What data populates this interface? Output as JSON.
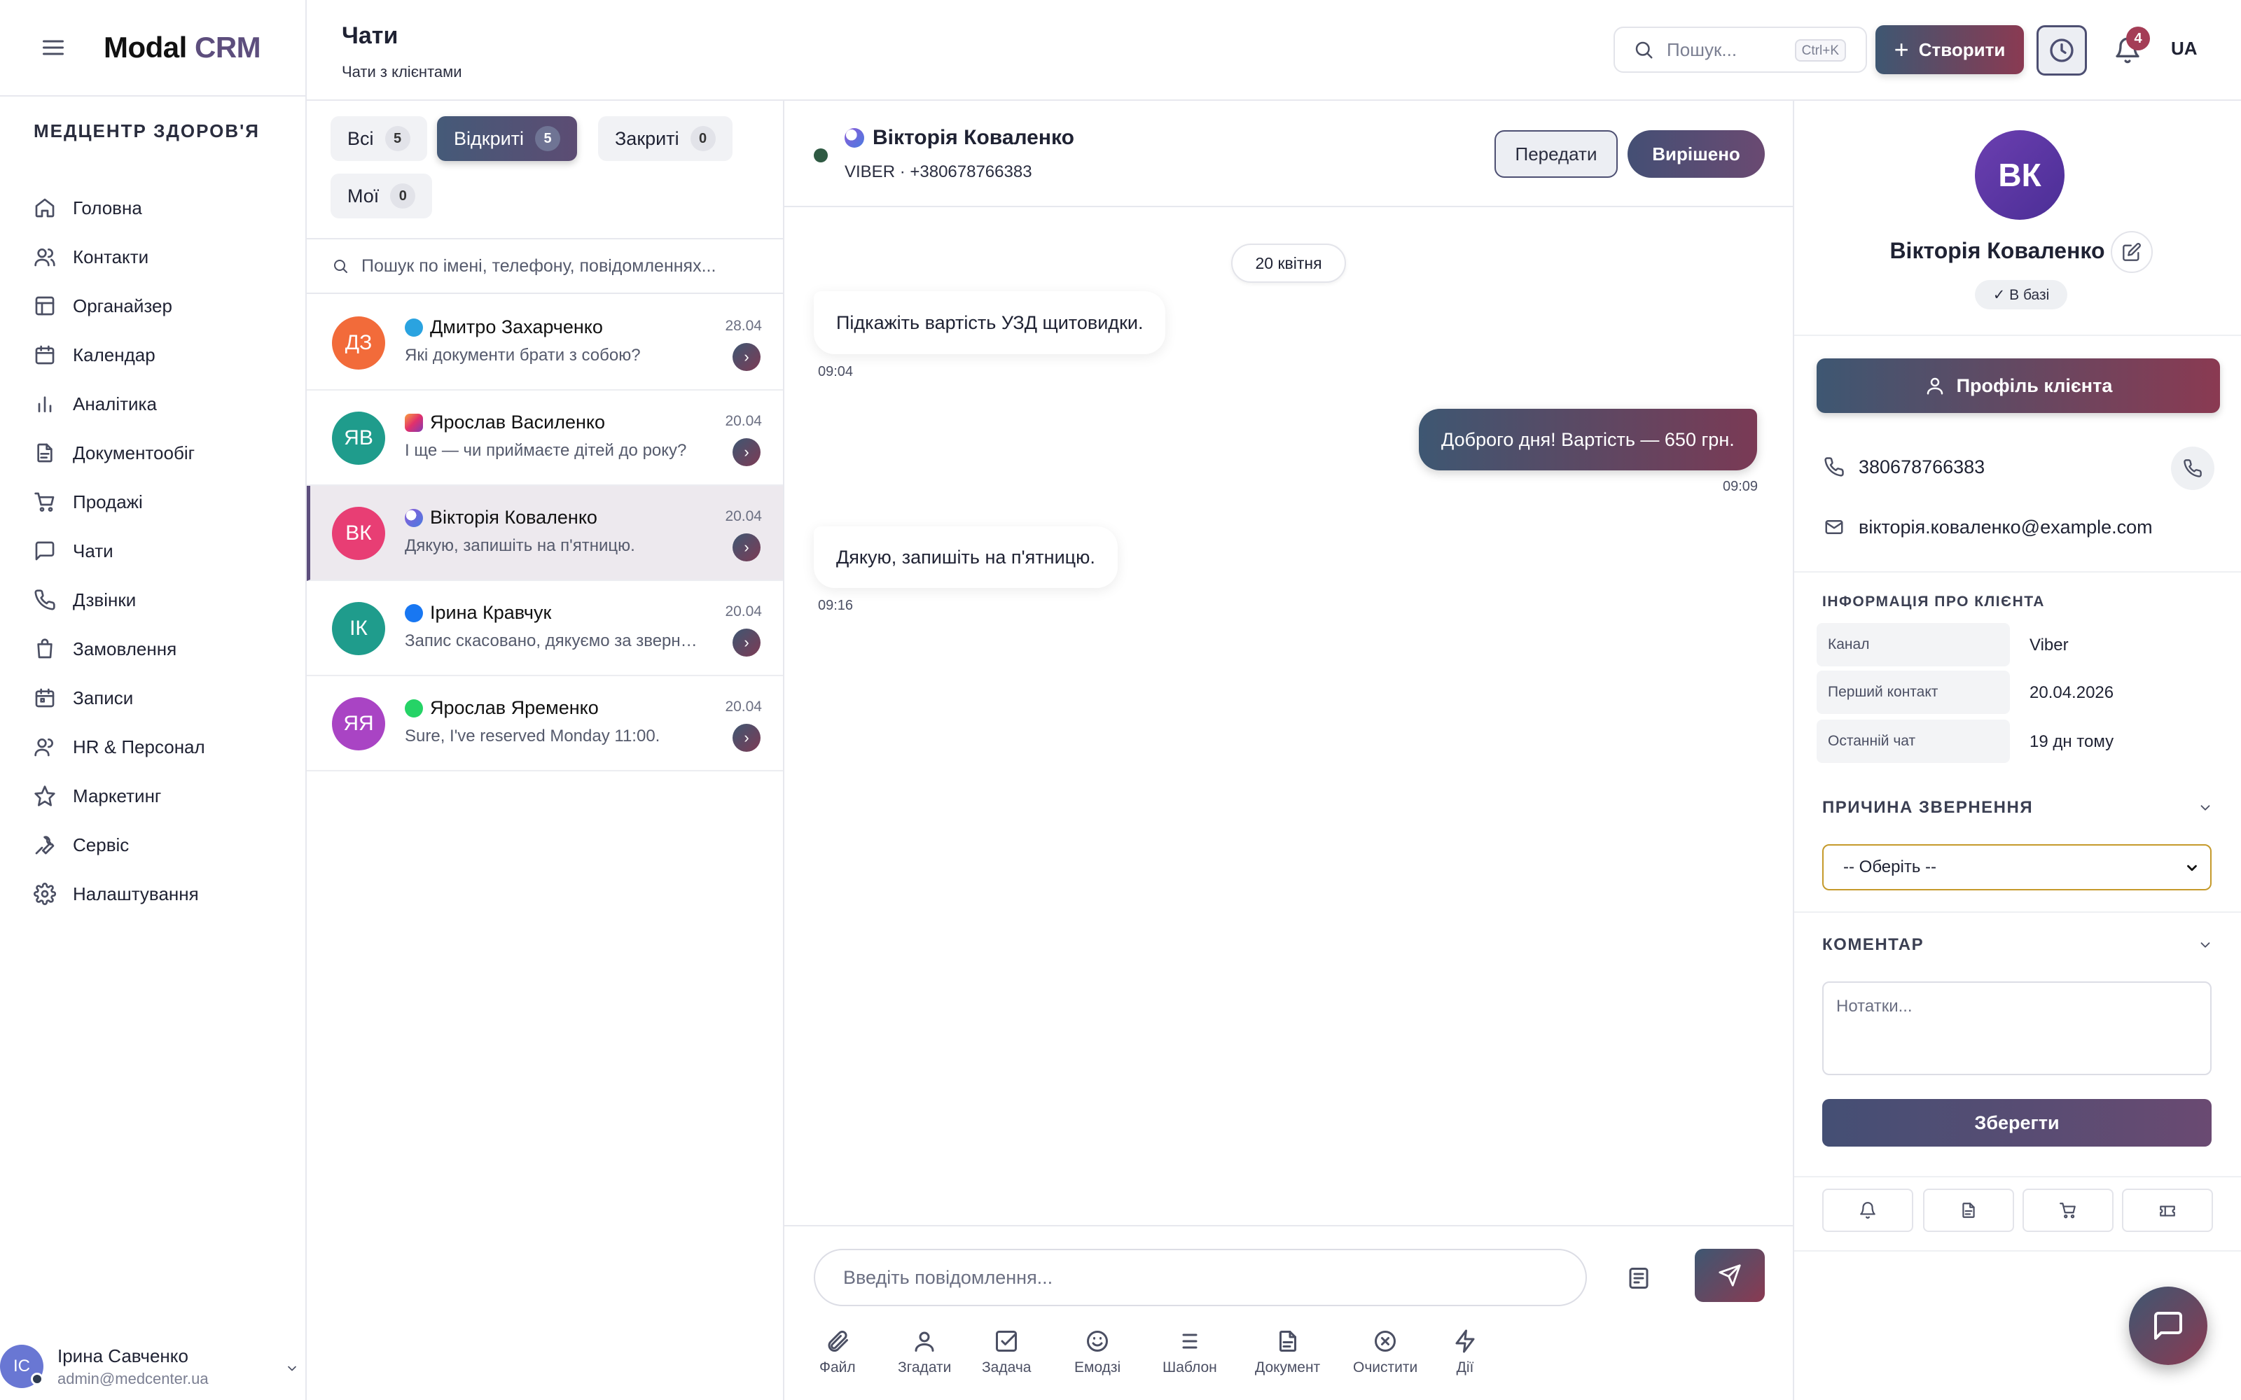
{
  "app": {
    "brand_main": "Modal",
    "brand_accent": "CRM",
    "org_name": "МЕДЦЕНТР ЗДОРОВ'Я"
  },
  "sidebar": {
    "items": [
      {
        "label": "Головна",
        "icon": "home-icon"
      },
      {
        "label": "Контакти",
        "icon": "users-icon"
      },
      {
        "label": "Органайзер",
        "icon": "layout-icon"
      },
      {
        "label": "Календар",
        "icon": "calendar-icon"
      },
      {
        "label": "Аналітика",
        "icon": "bar-chart-icon"
      },
      {
        "label": "Документообіг",
        "icon": "document-icon"
      },
      {
        "label": "Продажі",
        "icon": "cart-icon"
      },
      {
        "label": "Чати",
        "icon": "chat-icon"
      },
      {
        "label": "Дзвінки",
        "icon": "phone-icon"
      },
      {
        "label": "Замовлення",
        "icon": "bag-icon"
      },
      {
        "label": "Записи",
        "icon": "calendar-check-icon"
      },
      {
        "label": "HR & Персонал",
        "icon": "team-icon"
      },
      {
        "label": "Маркетинг",
        "icon": "star-icon"
      },
      {
        "label": "Сервіс",
        "icon": "wrench-icon"
      },
      {
        "label": "Налаштування",
        "icon": "gear-icon"
      }
    ],
    "user": {
      "initials": "IC",
      "name": "Ірина Савченко",
      "email": "admin@medcenter.ua"
    }
  },
  "header": {
    "title": "Чати",
    "subtitle": "Чати з клієнтами",
    "search_placeholder": "Пошук...",
    "search_shortcut": "Ctrl+K",
    "create_label": "Створити",
    "notifications_count": "4",
    "language": "UA"
  },
  "chat_list": {
    "filters": [
      {
        "label": "Всі",
        "count": "5"
      },
      {
        "label": "Відкриті",
        "count": "5"
      },
      {
        "label": "Закриті",
        "count": "0"
      },
      {
        "label": "Мої",
        "count": "0"
      }
    ],
    "search_placeholder": "Пошук по імені, телефону, повідомленнях...",
    "conversations": [
      {
        "initials": "ДЗ",
        "name": "Дмитро Захарченко",
        "preview": "Які документи брати з собою?",
        "date": "28.04",
        "channel": "telegram",
        "color": "#f26b3a"
      },
      {
        "initials": "ЯВ",
        "name": "Ярослав Василенко",
        "preview": "І ще — чи приймаєте дітей до року?",
        "date": "20.04",
        "channel": "instagram",
        "color": "#1f9c8c"
      },
      {
        "initials": "ВК",
        "name": "Вікторія Коваленко",
        "preview": "Дякую, запишіть на п'ятницю.",
        "date": "20.04",
        "channel": "viber",
        "color": "#e83e74"
      },
      {
        "initials": "ІК",
        "name": "Ірина Кравчук",
        "preview": "Запис скасовано, дякуємо за звернення",
        "date": "20.04",
        "channel": "facebook",
        "color": "#1f9c8c"
      },
      {
        "initials": "ЯЯ",
        "name": "Ярослав Яременко",
        "preview": "Sure, I've reserved Monday 11:00.",
        "date": "20.04",
        "channel": "whatsapp",
        "color": "#a944c4"
      }
    ]
  },
  "conversation": {
    "name": "Вікторія Коваленко",
    "meta": "VIBER · +380678766383",
    "transfer_label": "Передати",
    "resolve_label": "Вирішено",
    "date_label": "20 квітня",
    "messages": [
      {
        "direction": "in",
        "text": "Підкажіть вартість УЗД щитовидки.",
        "time": "09:04"
      },
      {
        "direction": "out",
        "text": "Доброго дня! Вартість — 650 грн.",
        "time": "09:09"
      },
      {
        "direction": "in",
        "text": "Дякую, запишіть на п'ятницю.",
        "time": "09:16"
      }
    ],
    "input_placeholder": "Введіть повідомлення...",
    "tools": [
      {
        "label": "Файл",
        "icon": "paperclip-icon"
      },
      {
        "label": "Згадати",
        "icon": "user-mention-icon"
      },
      {
        "label": "Задача",
        "icon": "task-icon"
      },
      {
        "label": "Емодзі",
        "icon": "emoji-icon"
      },
      {
        "label": "Шаблон",
        "icon": "list-icon"
      },
      {
        "label": "Документ",
        "icon": "document-icon"
      },
      {
        "label": "Очистити",
        "icon": "clear-icon"
      },
      {
        "label": "Дії",
        "icon": "lightning-icon"
      }
    ]
  },
  "client": {
    "initials": "ВК",
    "name": "Вікторія Коваленко",
    "status_badge": "✓ В базі",
    "profile_button": "Профіль клієнта",
    "phone": "380678766383",
    "email": "вікторія.коваленко@example.com",
    "info_title": "ІНФОРМАЦІЯ ПРО КЛІЄНТА",
    "info": [
      {
        "key": "Канал",
        "value": "Viber"
      },
      {
        "key": "Перший контакт",
        "value": "20.04.2026"
      },
      {
        "key": "Останній чат",
        "value": "19 дн тому"
      }
    ],
    "reason_title": "ПРИЧИНА ЗВЕРНЕННЯ",
    "reason_value": "-- Оберіть --",
    "comment_title": "КОМЕНТАР",
    "notes_placeholder": "Нотатки...",
    "save_label": "Зберегти"
  }
}
